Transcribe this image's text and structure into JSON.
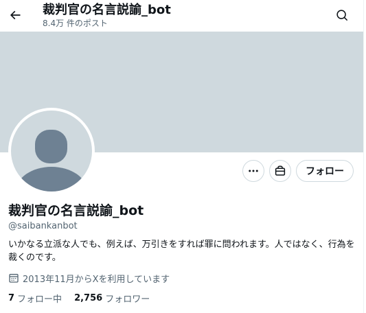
{
  "header": {
    "title": "裁判官の名言説諭_bot",
    "post_count": "8.4万 件のポスト",
    "back_icon": "arrow-left-icon",
    "search_icon": "search-icon"
  },
  "banner": {
    "color": "#cfd9de"
  },
  "profile": {
    "display_name": "裁判官の名言説諭_bot",
    "handle": "@saibankanbot",
    "bio": "いかなる立派な人でも、例えば、万引きをすれば罪に問われます。人ではなく、行為を裁くのです。",
    "joined": "2013年11月からXを利用しています",
    "calendar_icon": "calendar-icon"
  },
  "actions": {
    "more_icon": "more-icon",
    "subscribe_icon": "subscription-icon",
    "follow_label": "フォロー"
  },
  "stats": {
    "following_count": "7",
    "following_label": "フォロー中",
    "followers_count": "2,756",
    "followers_label": "フォロワー"
  },
  "colors": {
    "text_primary": "#0f1419",
    "text_secondary": "#536471",
    "border": "#cfd9de",
    "avatar_figure": "#6e8193"
  }
}
